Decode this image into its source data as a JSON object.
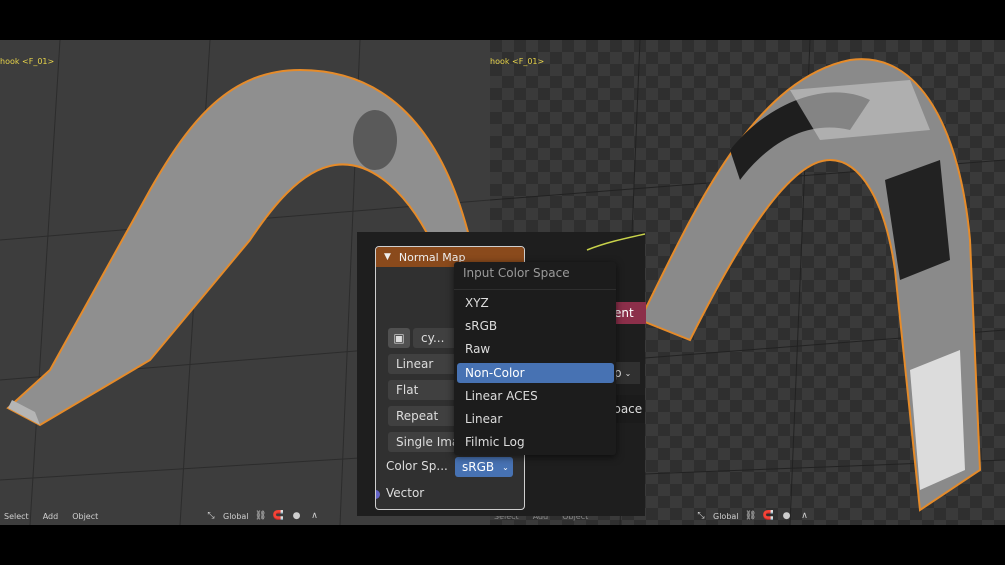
{
  "left_viewport": {
    "object_label": "hook <F_01>",
    "footer": {
      "menu": [
        "Select",
        "Add",
        "Object"
      ],
      "transform": "Global"
    }
  },
  "right_viewport": {
    "object_label": "hook <F_01>",
    "footer": {
      "menu": [
        "Select",
        "Add",
        "Object"
      ],
      "transform": "Global"
    }
  },
  "node_editor": {
    "node": {
      "title": "Normal Map",
      "image_name": "cy...",
      "interpolation": "Linear",
      "projection": "Flat",
      "extension": "Repeat",
      "source": "Single Image",
      "color_space_label": "Color Sp...",
      "color_space_value": "sRGB",
      "vector_socket": "Vector"
    },
    "side_node_label": "ent",
    "side_field_label": "p",
    "tooltip": "Color space"
  },
  "dropdown": {
    "title": "Input Color Space",
    "items": [
      "XYZ",
      "sRGB",
      "Raw",
      "Non-Color",
      "Linear ACES",
      "Linear",
      "Filmic Log"
    ],
    "selected": "Non-Color"
  },
  "colors": {
    "selection_outline": "#e58b2a",
    "node_header": "#8a4a1c",
    "accent": "#4772b3",
    "socket": "#6363c7"
  }
}
